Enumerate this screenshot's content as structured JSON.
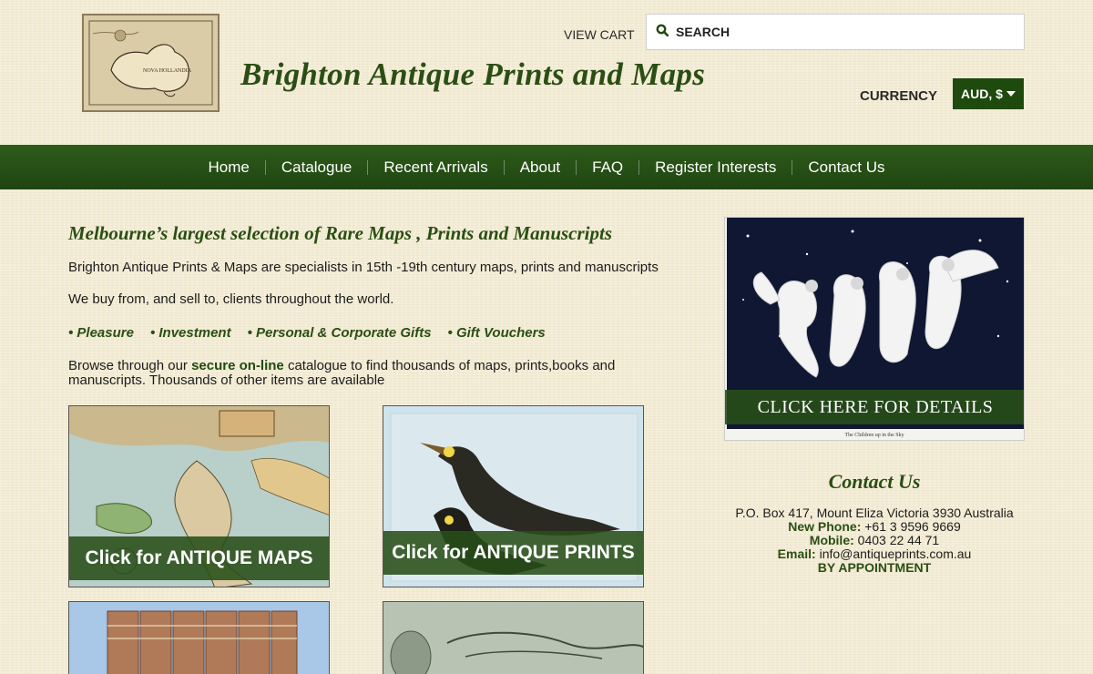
{
  "header": {
    "site_title": "Brighton Antique Prints and Maps",
    "view_cart": "VIEW CART",
    "search_placeholder": "SEARCH",
    "currency_label": "CURRENCY",
    "currency_value": "AUD, $"
  },
  "nav": {
    "items": [
      "Home",
      "Catalogue",
      "Recent Arrivals",
      "About",
      "FAQ",
      "Register Interests",
      "Contact Us"
    ]
  },
  "main": {
    "tagline": "Melbourne’s largest selection of Rare Maps , Prints and Manuscripts",
    "intro": "Brighton Antique Prints & Maps are specialists in 15th -19th century maps, prints and manuscripts",
    "buy_sell": "We buy from, and sell to, clients throughout the world.",
    "bullets": [
      "• Pleasure",
      "• Investment",
      "• Personal & Corporate Gifts",
      "• Gift Vouchers"
    ],
    "browse_before": "Browse through our ",
    "browse_link": "secure on-line",
    "browse_after": " catalogue to find thousands of maps, prints,books and manuscripts. Thousands of other items are available",
    "tiles": {
      "maps": "Click for ANTIQUE MAPS",
      "prints": "Click for ANTIQUE PRINTS"
    }
  },
  "sidebar": {
    "promo_button": "CLICK HERE FOR DETAILS",
    "promo_caption": "The Children up in the Sky",
    "contact_title": "Contact Us",
    "address": "P.O. Box 417, Mount Eliza Victoria 3930 Australia",
    "phone_label": "New Phone:",
    "phone": " +61 3 9596 9669",
    "mobile_label": "Mobile:",
    "mobile": " 0403 22 44 71",
    "email_label": "Email:",
    "email": " info@antiqueprints.com.au",
    "appointment": "BY APPOINTMENT"
  },
  "colors": {
    "brand_green": "#2b4e14",
    "nav_green": "#1f4a0e",
    "background": "#f3ecd4"
  }
}
